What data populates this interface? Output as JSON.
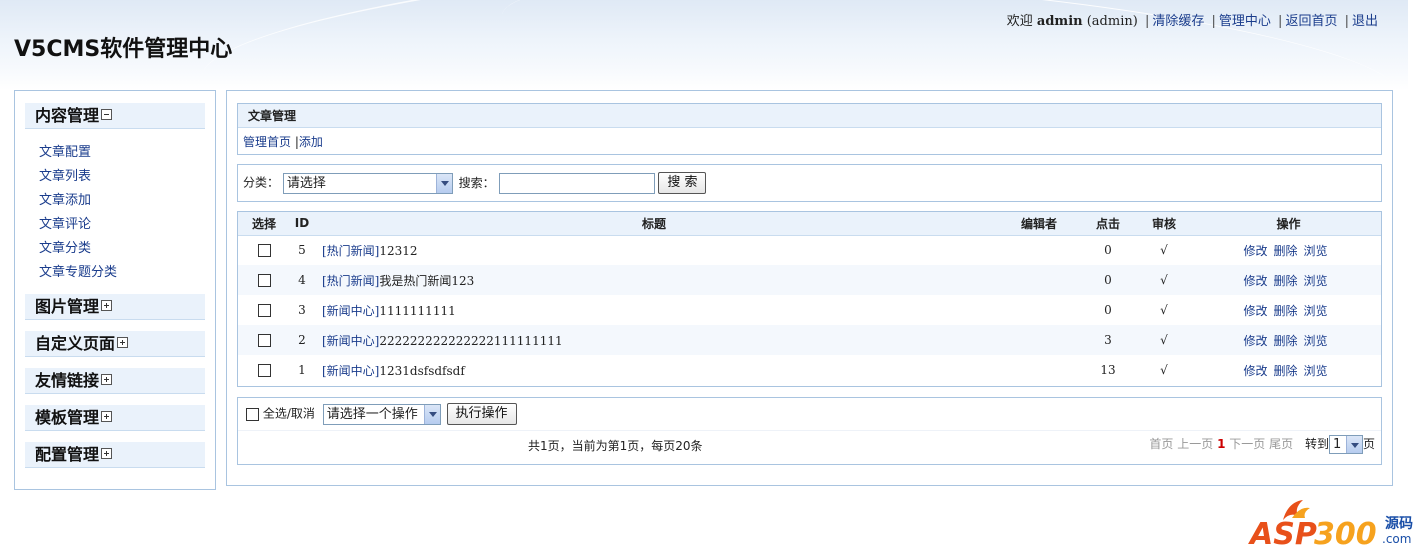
{
  "header": {
    "title": "V5CMS软件管理中心",
    "welcome": "欢迎",
    "username": "admin",
    "role": "(admin)",
    "links": [
      "清除缓存",
      "管理中心",
      "返回首页",
      "退出"
    ]
  },
  "sidebar": {
    "menus": [
      {
        "label": "内容管理",
        "expanded": true,
        "items": [
          "文章配置",
          "文章列表",
          "文章添加",
          "文章评论",
          "文章分类",
          "文章专题分类"
        ]
      },
      {
        "label": "图片管理",
        "expanded": false
      },
      {
        "label": "自定义页面",
        "expanded": false
      },
      {
        "label": "友情链接",
        "expanded": false
      },
      {
        "label": "模板管理",
        "expanded": false
      },
      {
        "label": "配置管理",
        "expanded": false
      }
    ]
  },
  "panel": {
    "title": "文章管理",
    "links": [
      "管理首页",
      "添加"
    ]
  },
  "search": {
    "category_label": "分类：",
    "category_value": "请选择",
    "search_label": "搜索：",
    "query": "",
    "button": "搜 索"
  },
  "table": {
    "headers": [
      "选择",
      "ID",
      "标题",
      "编辑者",
      "点击",
      "审核",
      "操作"
    ],
    "rows": [
      {
        "id": "5",
        "category": "[热门新闻]",
        "title": "12312",
        "editor": "",
        "clicks": "0",
        "review": "√"
      },
      {
        "id": "4",
        "category": "[热门新闻]",
        "title": "我是热门新闻123",
        "editor": "",
        "clicks": "0",
        "review": "√"
      },
      {
        "id": "3",
        "category": "[新闻中心]",
        "title": "1111111111",
        "editor": "",
        "clicks": "0",
        "review": "√"
      },
      {
        "id": "2",
        "category": "[新闻中心]",
        "title": "222222222222222111111111",
        "editor": "",
        "clicks": "3",
        "review": "√"
      },
      {
        "id": "1",
        "category": "[新闻中心]",
        "title": "1231dsfsdfsdf",
        "editor": "",
        "clicks": "13",
        "review": "√"
      }
    ],
    "actions": [
      "修改",
      "删除",
      "浏览"
    ]
  },
  "bulk": {
    "select_all": "全选/取消",
    "action_select": "请选择一个操作",
    "execute": "执行操作"
  },
  "pager": {
    "info": "共1页，当前为第1页，每页20条",
    "first": "首页",
    "prev": "上一页",
    "current": "1",
    "next": "下一页",
    "last": "尾页",
    "goto_label": "转到",
    "goto_value": "1",
    "page_suffix": "页"
  },
  "watermark": {
    "brand": "ASP300",
    "suffix": "源码",
    "domain": ".com"
  },
  "colors": {
    "link": "#1a3c8c",
    "border": "#a9c4e0",
    "head_bg": "#eaf2fb"
  }
}
